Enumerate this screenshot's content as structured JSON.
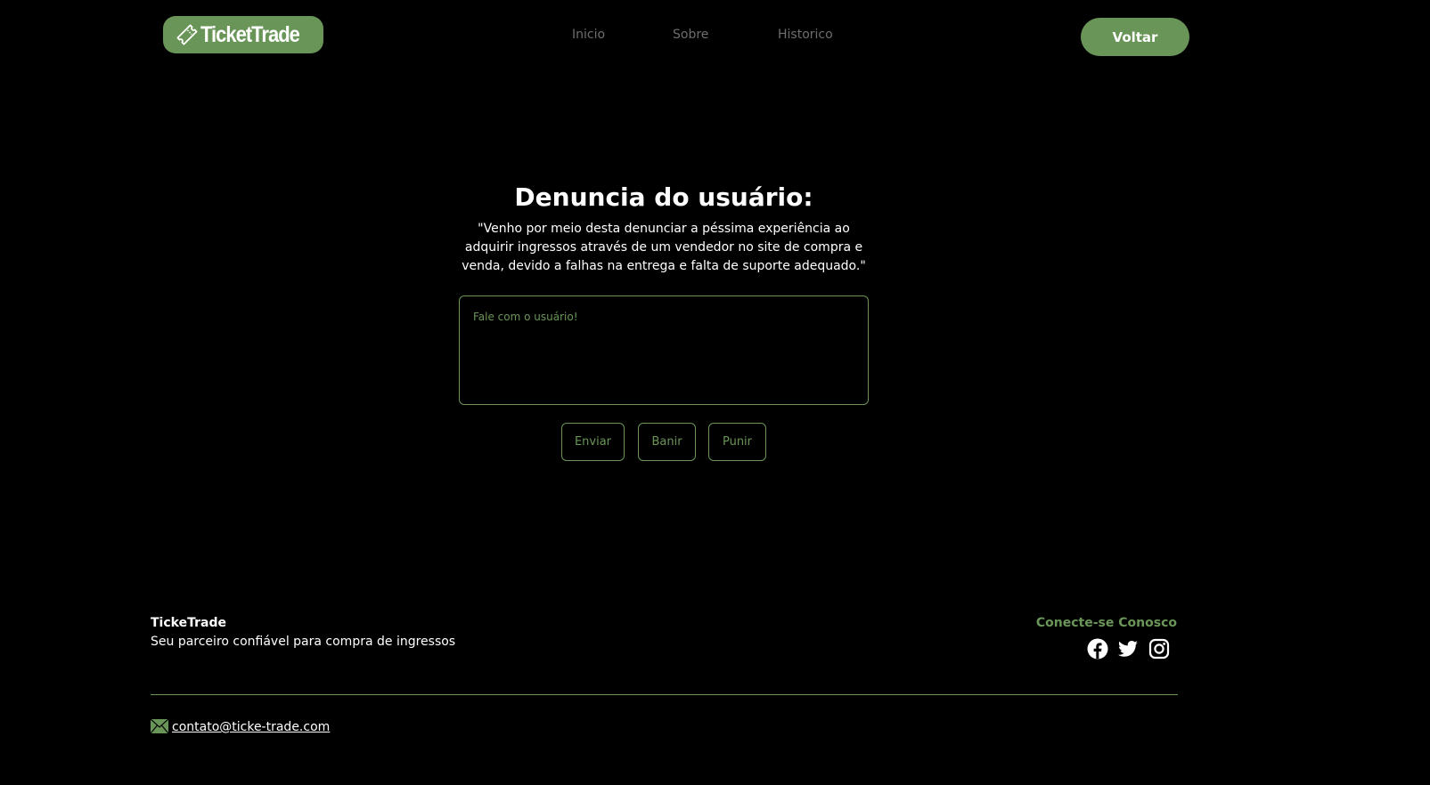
{
  "header": {
    "logo_text": "TicketTrade",
    "nav": {
      "inicio": "Inicio",
      "sobre": "Sobre",
      "historico": "Historico"
    },
    "back_label": "Voltar"
  },
  "main": {
    "title": "Denuncia do usuário:",
    "quote": "\"Venho por meio desta denunciar a péssima experiência ao adquirir ingressos através de um vendedor no site de compra e venda, devido a falhas na entrega e falta de suporte adequado.\"",
    "message_placeholder": "Fale com o usuário!",
    "message_value": "",
    "buttons": {
      "send": "Enviar",
      "ban": "Banir",
      "punish": "Punir"
    }
  },
  "footer": {
    "brand": "TickeTrade",
    "tagline": "Seu parceiro confiável para compra de ingressos",
    "connect_title": "Conecte-se Conosco",
    "social_icons": [
      "facebook-icon",
      "twitter-icon",
      "instagram-icon"
    ],
    "email": "contato@ticke-trade.com"
  },
  "colors": {
    "accent": "#6a9558",
    "background": "#000000",
    "nav_text": "#6d6d6d",
    "text": "#ffffff"
  }
}
